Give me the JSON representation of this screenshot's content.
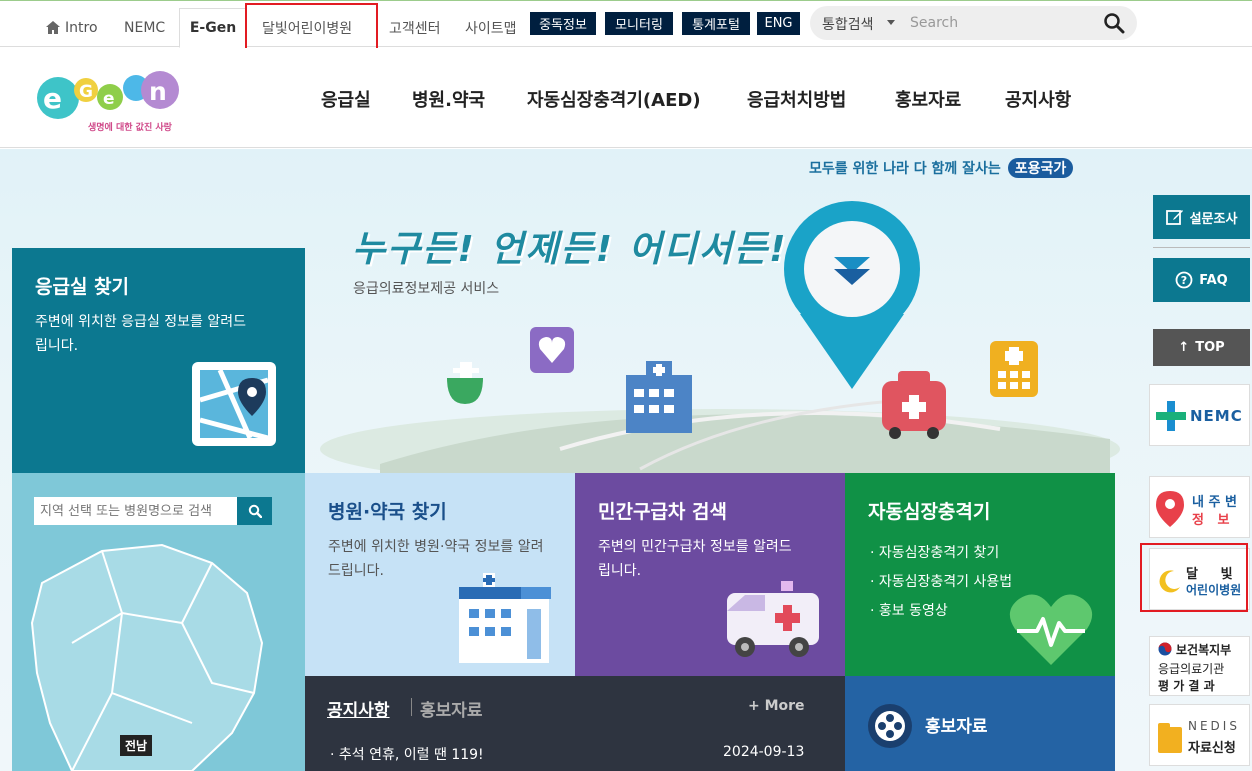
{
  "topnav": {
    "intro": "Intro",
    "nemc": "NEMC",
    "egen": "E-Gen",
    "moonlight": "달빛어린이병원",
    "customer": "고객센터",
    "sitemap": "사이트맵",
    "addiction": "중독정보",
    "monitoring": "모니터링",
    "stats": "통계포털",
    "eng": "ENG"
  },
  "search": {
    "scope": "통합검색",
    "placeholder": "Search"
  },
  "logo": {
    "tagline": "생명에 대한 값진 사랑"
  },
  "gnb": [
    "응급실",
    "병원.약국",
    "자동심장충격기(AED)",
    "응급처치방법",
    "홍보자료",
    "공지사항"
  ],
  "slogan": {
    "text": "모두를 위한 나라 다 함께 잘사는",
    "pill": "포용국가"
  },
  "hero": {
    "title": "누구든! 언제든! 어디서든!",
    "subtitle": "응급의료정보제공 서비스"
  },
  "er": {
    "title": "응급실 찾기",
    "desc": "주변에 위치한 응급실 정보를 알려드립니다.",
    "search_placeholder": "지역 선택 또는 병원명으로 검색",
    "region_label": "전남"
  },
  "hospital": {
    "title": "병원·약국 찾기",
    "desc": "주변에 위치한 병원·약국 정보를 알려드립니다."
  },
  "ambulance": {
    "title": "민간구급차 검색",
    "desc": "주변의 민간구급차 정보를 알려드립니다."
  },
  "aed": {
    "title": "자동심장충격기",
    "items": [
      "자동심장충격기 찾기",
      "자동심장충격기 사용법",
      "홍보 동영상"
    ]
  },
  "notice": {
    "tab_notice": "공지사항",
    "tab_promo": "홍보자료",
    "more": "+ More",
    "item": "추석 연휴, 이럴 땐 119!",
    "date": "2024-09-13"
  },
  "promo": {
    "title": "홍보자료"
  },
  "side": {
    "survey": "설문조사",
    "faq": "FAQ",
    "top": "TOP",
    "nemc": "NEMC",
    "my_area_1": "내 주 변",
    "my_area_2": "정   보",
    "moon_1": "달     빛",
    "moon_2": "어린이병원",
    "mohw_1": "보건복지부",
    "mohw_2": "응급의료기관",
    "mohw_3": "평 가 결 과",
    "nedis_1": "NEDIS",
    "nedis_2": "자료신청"
  },
  "colors": {
    "teal": "#0c7890",
    "purple": "#6c4ba0",
    "green": "#109146",
    "navy": "#001f3f",
    "highlight": "#e21b22"
  }
}
